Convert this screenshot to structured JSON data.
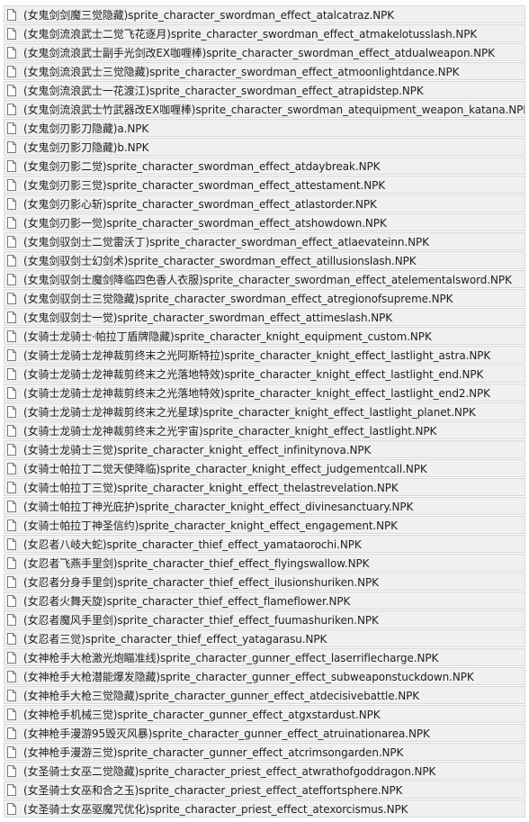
{
  "files": [
    "(女鬼剑剑魔三觉隐藏)sprite_character_swordman_effect_atalcatraz.NPK",
    "(女鬼剑流浪武士二觉飞花逐月)sprite_character_swordman_effect_atmakelotusslash.NPK",
    "(女鬼剑流浪武士副手光剑改EX咖喱棒)sprite_character_swordman_effect_atdualweapon.NPK",
    "(女鬼剑流浪武士三觉隐藏)sprite_character_swordman_effect_atmoonlightdance.NPK",
    "(女鬼剑流浪武士一花渡江)sprite_character_swordman_effect_atrapidstep.NPK",
    "(女鬼剑流浪武士竹武器改EX咖喱棒)sprite_character_swordman_atequipment_weapon_katana.NPK",
    "(女鬼剑刃影刀隐藏)a.NPK",
    "(女鬼剑刃影刀隐藏)b.NPK",
    "(女鬼剑刃影二觉)sprite_character_swordman_effect_atdaybreak.NPK",
    "(女鬼剑刃影三觉)sprite_character_swordman_effect_attestament.NPK",
    "(女鬼剑刃影心斩)sprite_character_swordman_effect_atlastorder.NPK",
    "(女鬼剑刃影一觉)sprite_character_swordman_effect_atshowdown.NPK",
    "(女鬼剑驭剑士二觉雷沃丁)sprite_character_swordman_effect_atlaevateinn.NPK",
    "(女鬼剑驭剑士幻剑术)sprite_character_swordman_effect_atillusionslash.NPK",
    "(女鬼剑驭剑士魔剑降临四色香人衣服)sprite_character_swordman_effect_atelementalsword.NPK",
    "(女鬼剑驭剑士三觉隐藏)sprite_character_swordman_effect_atregionofsupreme.NPK",
    "(女鬼剑驭剑士一觉)sprite_character_swordman_effect_attimeslash.NPK",
    "(女骑士龙骑士·帕拉丁盾牌隐藏)sprite_character_knight_equipment_custom.NPK",
    "(女骑士龙骑士龙神裁剪终末之光阿斯特拉)sprite_character_knight_effect_lastlight_astra.NPK",
    "(女骑士龙骑士龙神裁剪终末之光落地特效)sprite_character_knight_effect_lastlight_end.NPK",
    "(女骑士龙骑士龙神裁剪终末之光落地特效)sprite_character_knight_effect_lastlight_end2.NPK",
    "(女骑士龙骑士龙神裁剪终末之光星球)sprite_character_knight_effect_lastlight_planet.NPK",
    "(女骑士龙骑士龙神裁剪终末之光宇宙)sprite_character_knight_effect_lastlight.NPK",
    "(女骑士龙骑士三觉)sprite_character_knight_effect_infinitynova.NPK",
    "(女骑士帕拉丁二觉天使降临)sprite_character_knight_effect_judgementcall.NPK",
    "(女骑士帕拉丁三觉)sprite_character_knight_effect_thelastrevelation.NPK",
    "(女骑士帕拉丁神光庇护)sprite_character_knight_effect_divinesanctuary.NPK",
    "(女骑士帕拉丁神圣信约)sprite_character_knight_effect_engagement.NPK",
    "(女忍者八岐大蛇)sprite_character_thief_effect_yamataorochi.NPK",
    "(女忍者飞燕手里剑)sprite_character_thief_effect_flyingswallow.NPK",
    "(女忍者分身手里剑)sprite_character_thief_effect_ilusionshuriken.NPK",
    "(女忍者火舞天旋)sprite_character_thief_effect_flameflower.NPK",
    "(女忍者魔风手里剑)sprite_character_thief_effect_fuumashuriken.NPK",
    "(女忍者三觉)sprite_character_thief_effect_yatagarasu.NPK",
    "(女神枪手大枪激光炮瞄准线)sprite_character_gunner_effect_laserriflecharge.NPK",
    "(女神枪手大枪潜能爆发隐藏)sprite_character_gunner_effect_subweaponstuckdown.NPK",
    "(女神枪手大枪三觉隐藏)sprite_character_gunner_effect_atdecisivebattle.NPK",
    "(女神枪手机械三觉)sprite_character_gunner_effect_atgxstardust.NPK",
    "(女神枪手漫游95毁灭风暴)sprite_character_gunner_effect_atruinationarea.NPK",
    "(女神枪手漫游三觉)sprite_character_gunner_effect_atcrimsongarden.NPK",
    "(女圣骑士女巫二觉隐藏)sprite_character_priest_effect_atwrathofgoddragon.NPK",
    "(女圣骑士女巫和合之玉)sprite_character_priest_effect_ateffortsphere.NPK",
    "(女圣骑士女巫驱魔咒优化)sprite_character_priest_effect_atexorcismus.NPK"
  ],
  "icons": {
    "file": "document-icon"
  },
  "colors": {
    "row_bg": "#f0f0f0",
    "row_border": "#d9d9d9",
    "text": "#1f1f1f"
  }
}
